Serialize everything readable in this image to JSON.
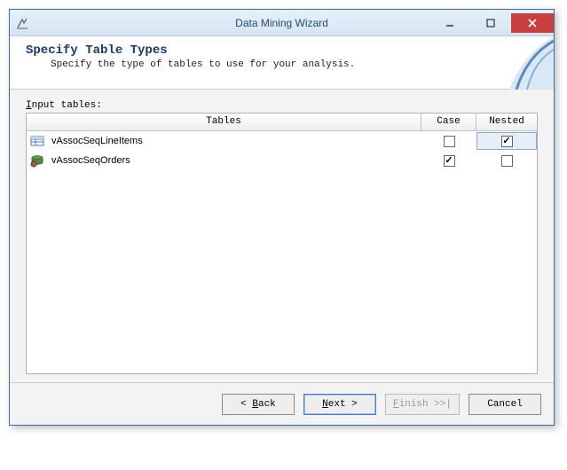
{
  "window": {
    "title": "Data Mining Wizard"
  },
  "header": {
    "title": "Specify Table Types",
    "subtitle": "Specify the type of tables to use for your analysis."
  },
  "content": {
    "input_tables_label": "Input tables:",
    "columns": {
      "tables": "Tables",
      "case": "Case",
      "nested": "Nested"
    },
    "rows": [
      {
        "name": "vAssocSeqLineItems",
        "case": false,
        "nested": true,
        "nested_selected": true,
        "icon": "table-icon"
      },
      {
        "name": "vAssocSeqOrders",
        "case": true,
        "nested": false,
        "nested_selected": false,
        "icon": "cube-icon"
      }
    ]
  },
  "buttons": {
    "back": "< Back",
    "next": "Next >",
    "finish": "Finish >>|",
    "cancel": "Cancel"
  }
}
